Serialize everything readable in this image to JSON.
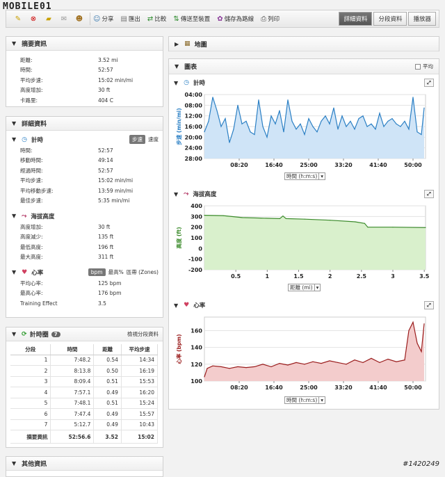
{
  "logo": "MOBILE01",
  "watermark": "#1420249",
  "toolbar": {
    "actions": [
      {
        "label": "分享",
        "icon": "share-icon"
      },
      {
        "label": "匯出",
        "icon": "export-icon"
      },
      {
        "label": "比較",
        "icon": "compare-icon"
      },
      {
        "label": "傳送至裝置",
        "icon": "send-to-device-icon"
      },
      {
        "label": "儲存為路線",
        "icon": "save-course-icon"
      },
      {
        "label": "列印",
        "icon": "print-icon"
      }
    ],
    "view_tabs": [
      "詳細資料",
      "分段資料",
      "播放器"
    ],
    "active_tab": "詳細資料"
  },
  "summary": {
    "title": "摘要資訊",
    "rows": [
      {
        "k": "距離:",
        "v": "3.52 mi"
      },
      {
        "k": "時間:",
        "v": "52:57"
      },
      {
        "k": "平均步速:",
        "v": "15:02 min/mi"
      },
      {
        "k": "高度增加:",
        "v": "30 ft"
      },
      {
        "k": "卡路里:",
        "v": "404 C"
      }
    ]
  },
  "details": {
    "title": "詳細資料",
    "timing": {
      "title": "計時",
      "toggle_on": "步速",
      "toggle_off": "速度",
      "rows": [
        {
          "k": "時間:",
          "v": "52:57"
        },
        {
          "k": "移動時間:",
          "v": "49:14"
        },
        {
          "k": "經過時間:",
          "v": "52:57"
        },
        {
          "k": "平均步速:",
          "v": "15:02 min/mi"
        },
        {
          "k": "平均移動步速:",
          "v": "13:59 min/mi"
        },
        {
          "k": "最佳步速:",
          "v": "5:35 min/mi"
        }
      ]
    },
    "elevation": {
      "title": "海拔高度",
      "rows": [
        {
          "k": "高度增加:",
          "v": "30 ft"
        },
        {
          "k": "高度減少:",
          "v": "135 ft"
        },
        {
          "k": "最低高度:",
          "v": "196 ft"
        },
        {
          "k": "最大高度:",
          "v": "311 ft"
        }
      ]
    },
    "heart": {
      "title": "心率",
      "toggles": [
        "bpm",
        "最高%",
        "區帶 (Zones)"
      ],
      "rows": [
        {
          "k": "平均心率:",
          "v": "125 bpm"
        },
        {
          "k": "最高心率:",
          "v": "176 bpm"
        },
        {
          "k": "Training Effect",
          "v": "3.5"
        }
      ]
    }
  },
  "laps": {
    "title": "計時圈",
    "count": "7",
    "link": "檢視分段資料",
    "headers": [
      "分段",
      "時間",
      "距離",
      "平均步速"
    ],
    "rows": [
      [
        "1",
        "7:48.2",
        "0.54",
        "14:34"
      ],
      [
        "2",
        "8:13.8",
        "0.50",
        "16:19"
      ],
      [
        "3",
        "8:09.4",
        "0.51",
        "15:53"
      ],
      [
        "4",
        "7:57.1",
        "0.49",
        "16:20"
      ],
      [
        "5",
        "7:48.1",
        "0.51",
        "15:24"
      ],
      [
        "6",
        "7:47.4",
        "0.49",
        "15:57"
      ],
      [
        "7",
        "5:12.7",
        "0.49",
        "10:43"
      ]
    ],
    "total": [
      "摘要資訊",
      "52:56.6",
      "3.52",
      "15:02"
    ]
  },
  "other": {
    "title": "其他資訊"
  },
  "map": {
    "title": "地圖"
  },
  "charts": {
    "title": "圖表",
    "average_label": "平均",
    "x_selector": "時間 (h:m:s)",
    "x_selector_dist": "距離 (mi)"
  },
  "chart_data": [
    {
      "type": "area",
      "title": "計時",
      "ylabel": "步速 (min/mi)",
      "xlabel": "時間 (h:m:s)",
      "color": "#2a7fc4",
      "y_ticks": [
        "04:00",
        "08:00",
        "12:00",
        "16:00",
        "20:00",
        "24:00",
        "28:00"
      ],
      "x_ticks": [
        "08:20",
        "16:40",
        "25:00",
        "33:20",
        "41:40",
        "50:00"
      ],
      "x_tick_values": [
        500,
        1000,
        1500,
        2000,
        2500,
        3000
      ],
      "ylim_minutes": [
        4,
        28
      ],
      "y_inverted": true,
      "xlim_seconds": [
        0,
        3180
      ],
      "x": [
        0,
        60,
        120,
        180,
        240,
        300,
        360,
        420,
        480,
        540,
        600,
        660,
        720,
        780,
        840,
        900,
        960,
        1020,
        1080,
        1140,
        1200,
        1260,
        1320,
        1380,
        1440,
        1500,
        1560,
        1620,
        1680,
        1740,
        1800,
        1860,
        1920,
        1980,
        2040,
        2100,
        2160,
        2220,
        2280,
        2340,
        2400,
        2460,
        2520,
        2580,
        2640,
        2700,
        2760,
        2820,
        2880,
        2940,
        3000,
        3060,
        3120,
        3160
      ],
      "values": [
        18,
        14,
        5,
        10,
        16,
        13,
        22,
        17,
        8,
        15,
        14,
        18,
        19,
        6,
        16,
        20,
        12,
        15,
        10,
        18,
        6,
        14,
        17,
        15,
        19,
        13,
        16,
        18,
        14,
        12,
        15,
        9,
        17,
        12,
        16,
        14,
        17,
        13,
        12,
        16,
        15,
        17,
        11,
        16,
        14,
        13,
        15,
        16,
        14,
        17,
        5,
        18,
        19,
        9
      ]
    },
    {
      "type": "area",
      "title": "海拔高度",
      "ylabel": "高度 (ft)",
      "xlabel": "距離 (mi)",
      "color": "#3a8a2a",
      "y_ticks": [
        "400",
        "300",
        "200",
        "100",
        "0",
        "-100",
        "-200"
      ],
      "x_ticks": [
        "0.5",
        "1",
        "1.5",
        "2",
        "2.5",
        "3",
        "3.5"
      ],
      "x_tick_values": [
        0.5,
        1,
        1.5,
        2,
        2.5,
        3,
        3.5
      ],
      "ylim": [
        -200,
        400
      ],
      "xlim": [
        0,
        3.52
      ],
      "x": [
        0,
        0.3,
        0.6,
        0.9,
        1.2,
        1.25,
        1.3,
        1.6,
        2.0,
        2.4,
        2.55,
        2.6,
        3.0,
        3.52
      ],
      "values": [
        311,
        308,
        290,
        285,
        280,
        305,
        280,
        275,
        265,
        250,
        235,
        200,
        200,
        196
      ]
    },
    {
      "type": "area",
      "title": "心率",
      "ylabel": "心率 (bpm)",
      "xlabel": "時間 (h:m:s)",
      "color": "#9a1c1c",
      "y_ticks": [
        "160",
        "140",
        "120",
        "100"
      ],
      "x_ticks": [
        "08:20",
        "16:40",
        "25:00",
        "33:20",
        "41:40",
        "50:00"
      ],
      "x_tick_values": [
        500,
        1000,
        1500,
        2000,
        2500,
        3000
      ],
      "ylim": [
        100,
        176
      ],
      "xlim_seconds": [
        0,
        3180
      ],
      "x": [
        0,
        40,
        120,
        240,
        360,
        480,
        600,
        720,
        840,
        960,
        1080,
        1200,
        1320,
        1440,
        1560,
        1680,
        1800,
        1920,
        2040,
        2160,
        2280,
        2400,
        2520,
        2640,
        2760,
        2880,
        2940,
        3000,
        3060,
        3120,
        3160
      ],
      "values": [
        105,
        115,
        118,
        117,
        115,
        117,
        116,
        117,
        120,
        117,
        121,
        119,
        122,
        120,
        123,
        121,
        124,
        122,
        120,
        125,
        122,
        127,
        122,
        126,
        123,
        125,
        160,
        170,
        145,
        135,
        168
      ]
    }
  ]
}
